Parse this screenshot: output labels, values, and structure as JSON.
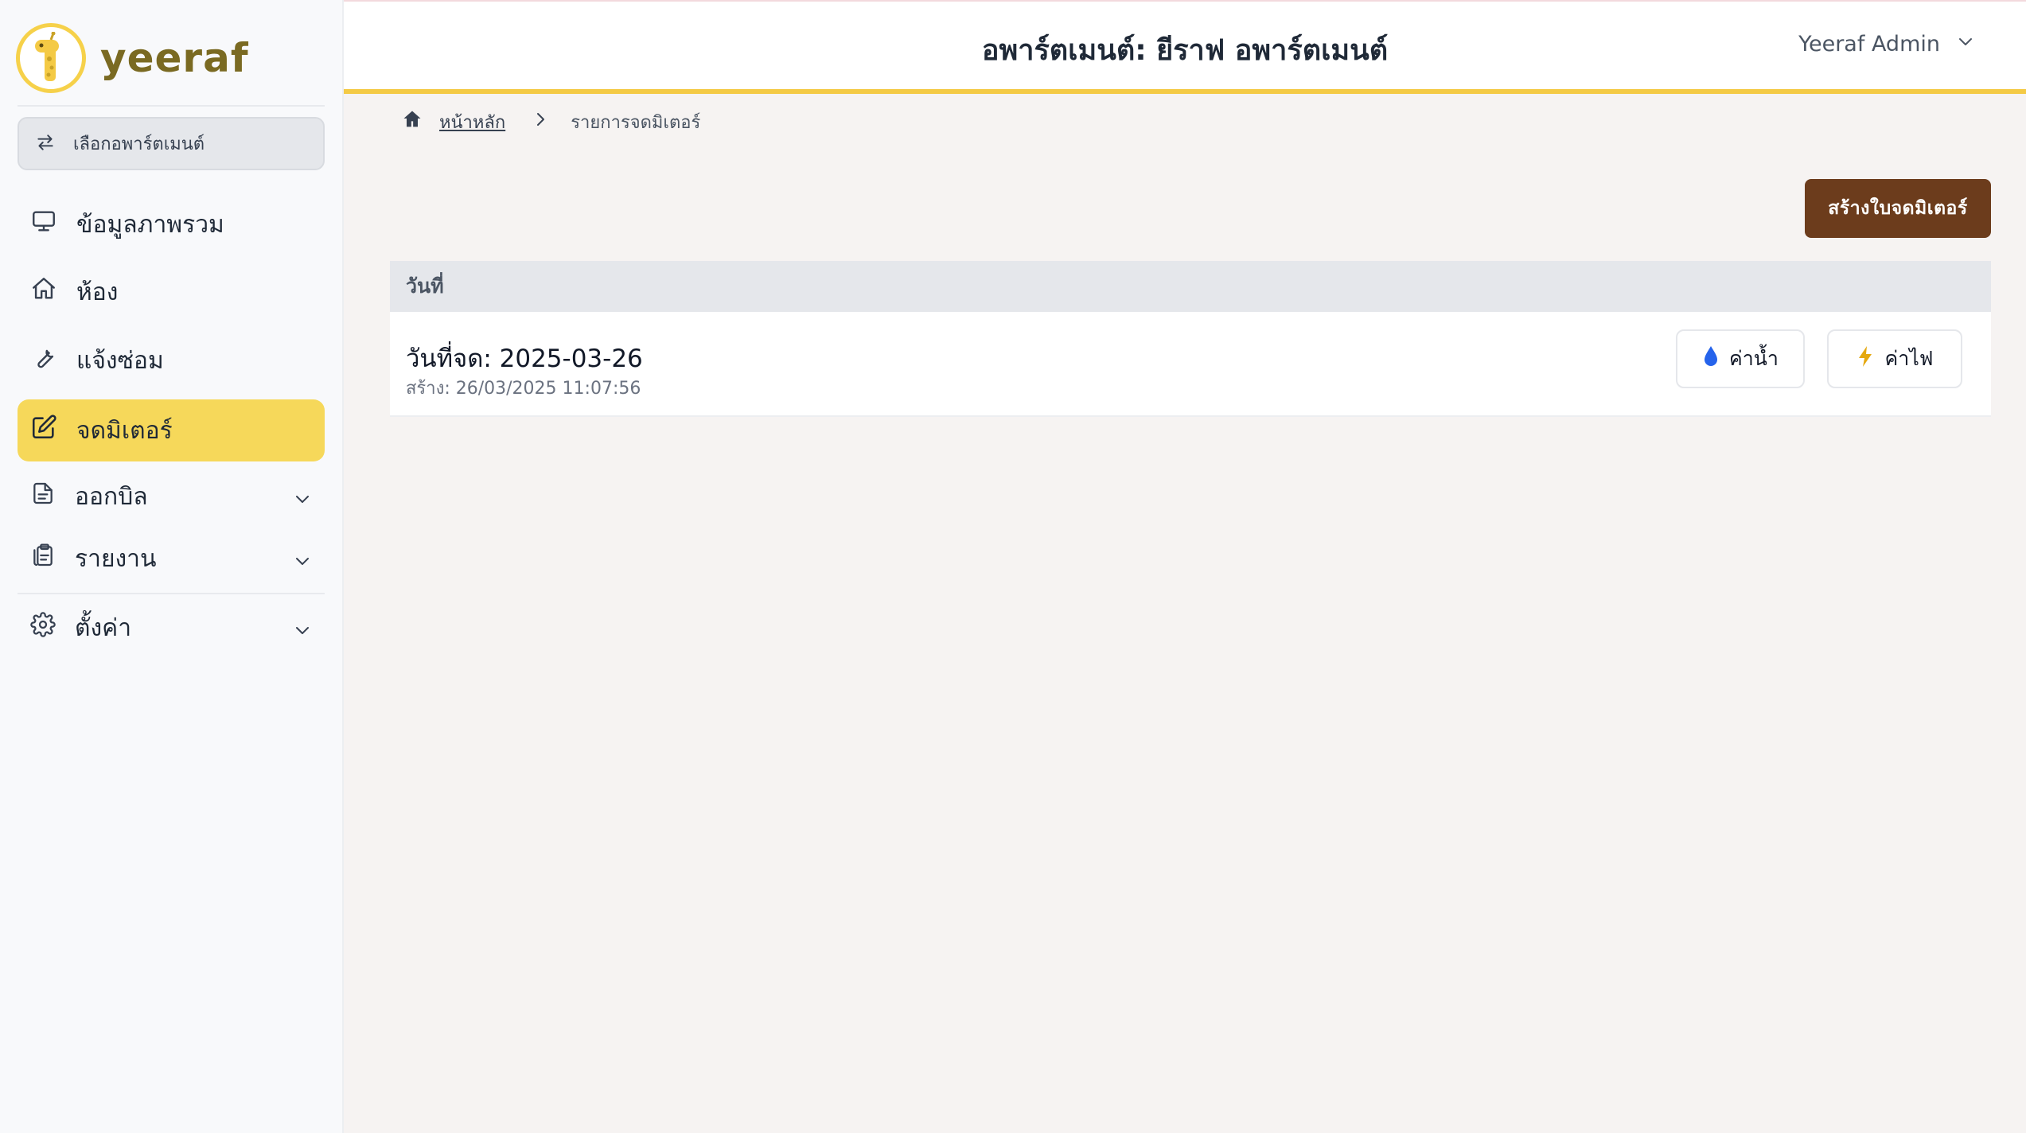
{
  "brand": {
    "name": "yeeraf",
    "accent": "#f4ca45"
  },
  "sidebar": {
    "apartment_select_label": "เลือกอพาร์ตเมนต์",
    "items": [
      {
        "label": "ข้อมูลภาพรวม",
        "icon": "monitor-icon",
        "active": false
      },
      {
        "label": "ห้อง",
        "icon": "home-icon",
        "active": false
      },
      {
        "label": "แจ้งซ่อม",
        "icon": "wrench-icon",
        "active": false
      },
      {
        "label": "จดมิเตอร์",
        "icon": "pencil-square-icon",
        "active": true
      },
      {
        "label": "ออกบิล",
        "icon": "document-icon",
        "active": false,
        "expandable": true
      },
      {
        "label": "รายงาน",
        "icon": "clipboard-icon",
        "active": false,
        "expandable": true
      },
      {
        "label": "ตั้งค่า",
        "icon": "gear-icon",
        "active": false,
        "expandable": true
      }
    ]
  },
  "header": {
    "title": "อพาร์ตเมนต์: ยีราฟ อพาร์ตเมนต์",
    "user_name": "Yeeraf Admin"
  },
  "breadcrumb": {
    "home": "หน้าหลัก",
    "current": "รายการจดมิเตอร์"
  },
  "actions": {
    "create_label": "สร้างใบจดมิเตอร์"
  },
  "table": {
    "header": "วันที่",
    "rows": [
      {
        "title": "วันที่จด: 2025-03-26",
        "created": "สร้าง: 26/03/2025 11:07:56",
        "water_label": "ค่าน้ำ",
        "electric_label": "ค่าไฟ"
      }
    ]
  },
  "colors": {
    "active_nav": "#f6d85a",
    "create_button": "#6c3c1c",
    "water_icon": "#2563eb",
    "electric_icon": "#e5a80f"
  }
}
